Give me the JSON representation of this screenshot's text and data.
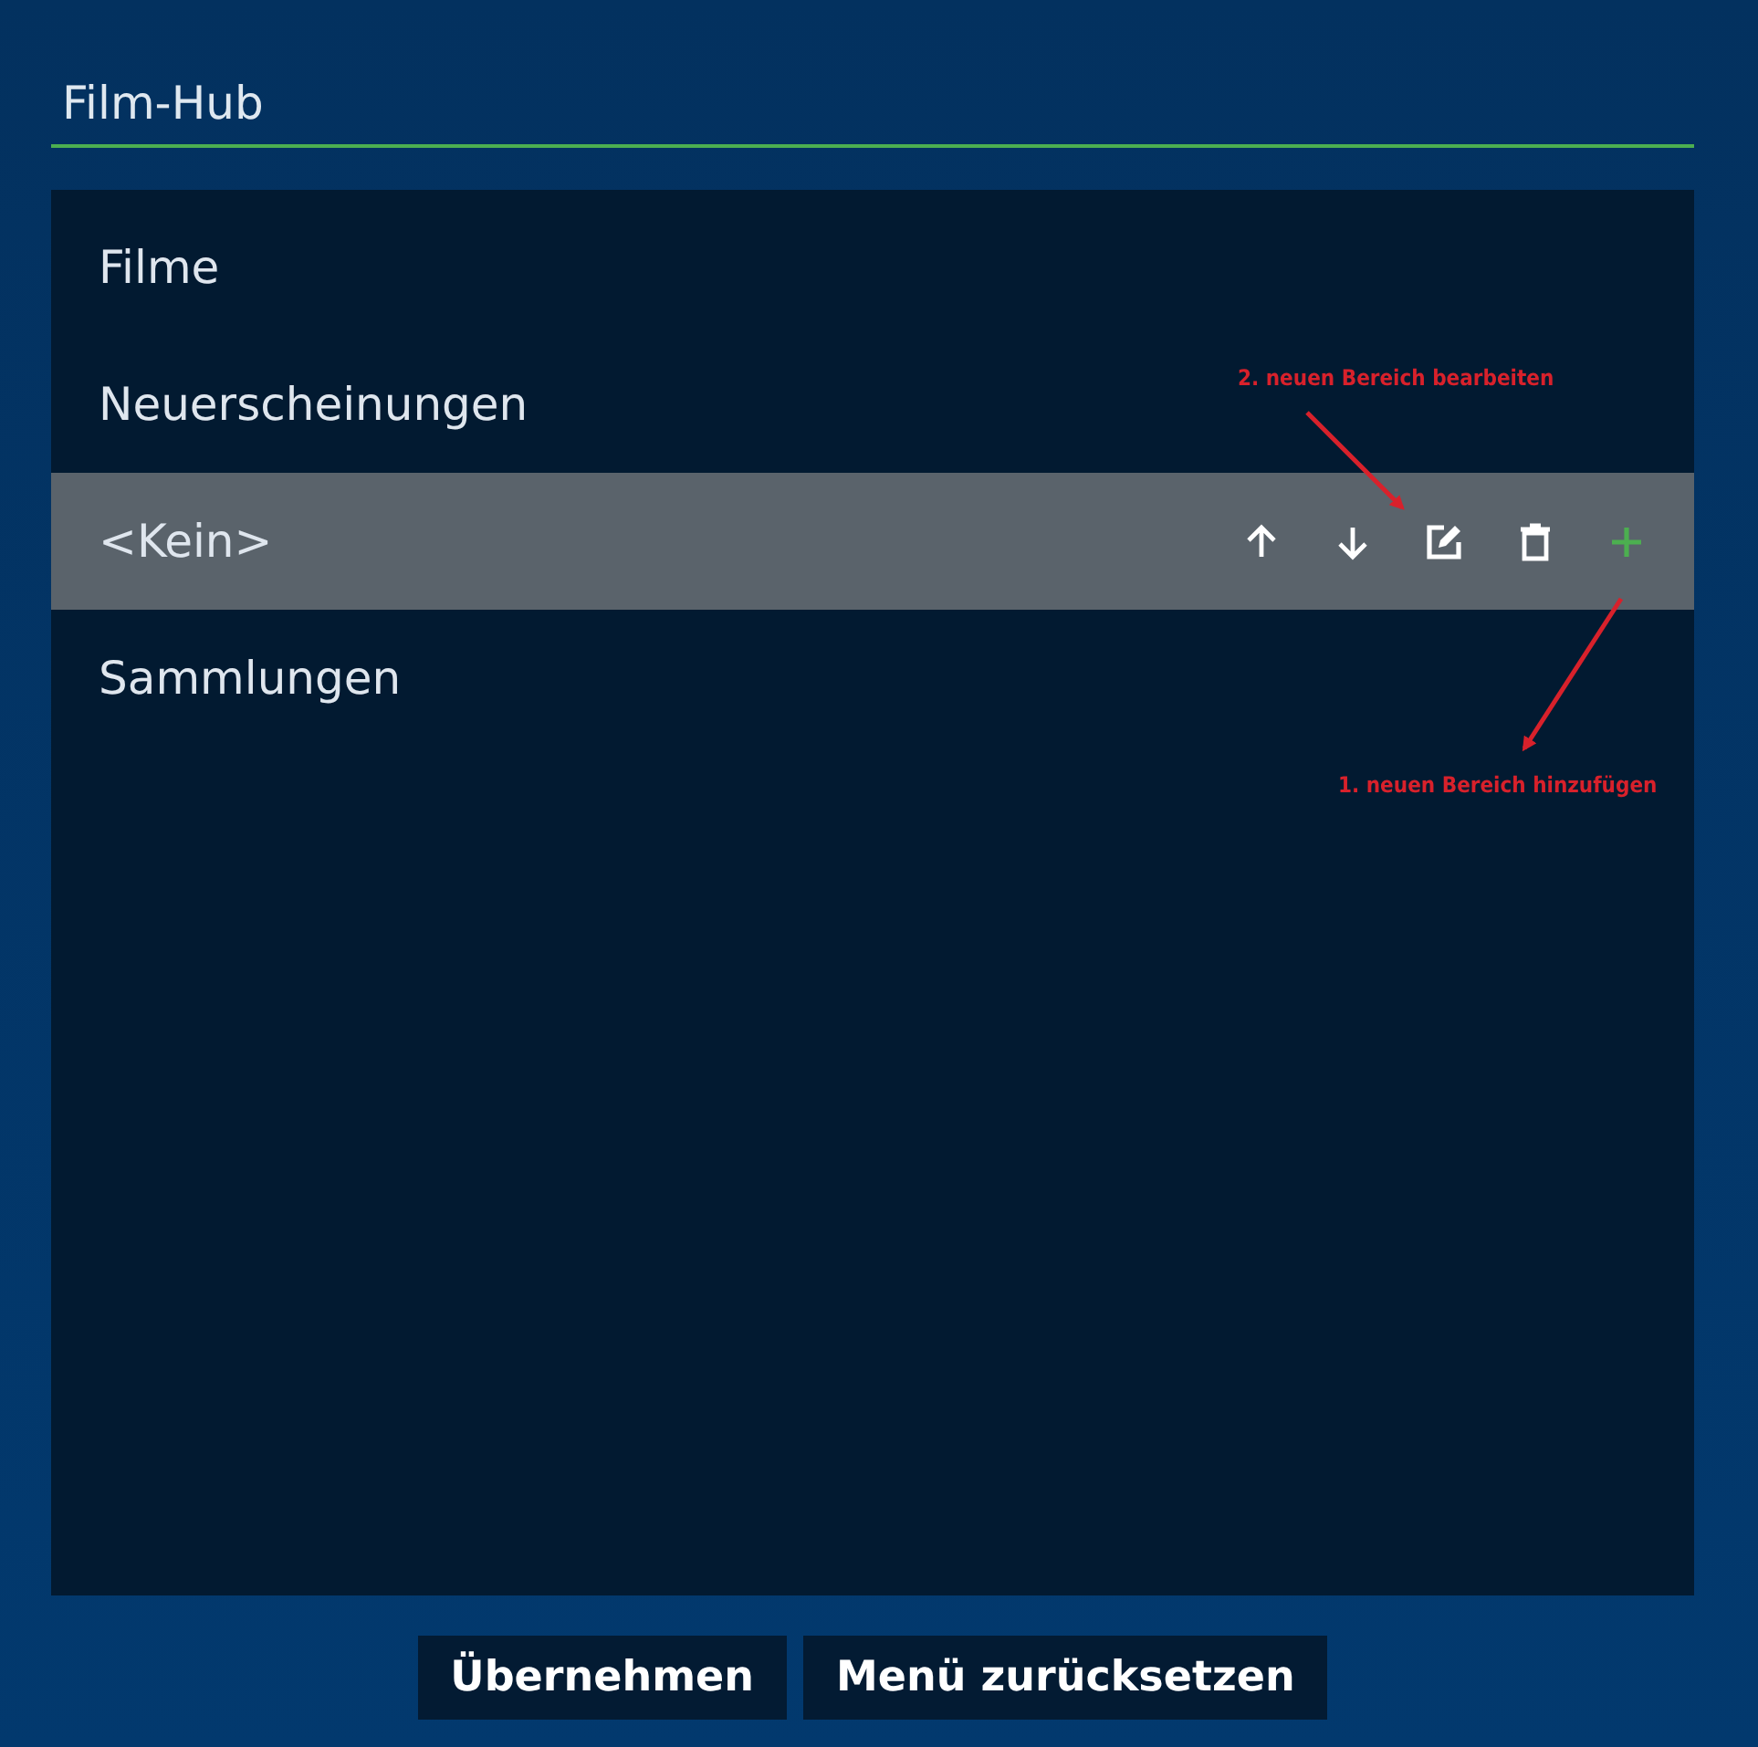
{
  "dialog": {
    "title": "Film-Hub"
  },
  "items": [
    {
      "label": "Filme",
      "selected": false
    },
    {
      "label": "Neuerscheinungen",
      "selected": false
    },
    {
      "label": "<Kein>",
      "selected": true
    },
    {
      "label": "Sammlungen",
      "selected": false
    }
  ],
  "row_actions": [
    {
      "kind": "up"
    },
    {
      "kind": "down"
    },
    {
      "kind": "edit"
    },
    {
      "kind": "delete"
    },
    {
      "kind": "add"
    }
  ],
  "annotations": [
    {
      "text": "2. neuen Bereich bearbeiten"
    },
    {
      "text": "1. neuen Bereich hinzufügen"
    }
  ],
  "buttons": [
    "Übernehmen",
    "Menü zurücksetzen"
  ]
}
